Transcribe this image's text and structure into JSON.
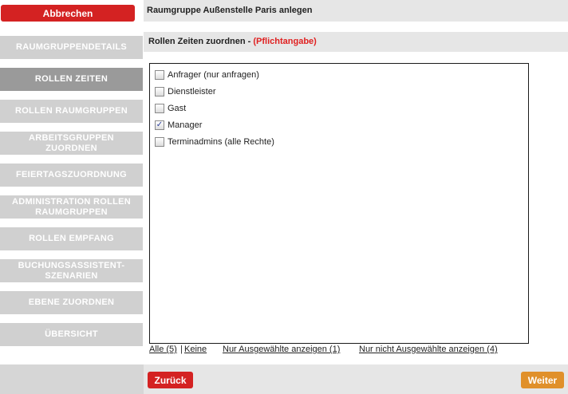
{
  "sidebar": {
    "cancel_label": "Abbrechen",
    "items": [
      {
        "label": "RAUMGRUPPENDETAILS",
        "active": false
      },
      {
        "label": "ROLLEN ZEITEN",
        "active": true
      },
      {
        "label": "ROLLEN RAUMGRUPPEN",
        "active": false
      },
      {
        "label": "ARBEITSGRUPPEN ZUORDNEN",
        "active": false
      },
      {
        "label": "FEIERTAGSZUORDNUNG",
        "active": false
      },
      {
        "label": "ADMINISTRATION ROLLEN RAUMGRUPPEN",
        "active": false
      },
      {
        "label": "ROLLEN EMPFANG",
        "active": false
      },
      {
        "label": "BUCHUNGSASSISTENT-SZENARIEN",
        "active": false
      },
      {
        "label": "EBENE ZUORDNEN",
        "active": false
      },
      {
        "label": "ÜBERSICHT",
        "active": false
      }
    ]
  },
  "header": {
    "title": "Raumgruppe Außenstelle Paris anlegen"
  },
  "section": {
    "title": "Rollen Zeiten zuordnen - ",
    "required": "(Pflichtangabe)"
  },
  "roles": [
    {
      "label": "Anfrager (nur anfragen)",
      "checked": false
    },
    {
      "label": "Dienstleister",
      "checked": false
    },
    {
      "label": "Gast",
      "checked": false
    },
    {
      "label": "Manager",
      "checked": true
    },
    {
      "label": "Terminadmins (alle Rechte)",
      "checked": false
    }
  ],
  "links": {
    "all": "Alle (5)",
    "separator": "|",
    "none": "Keine",
    "show_selected": "Nur Ausgewählte anzeigen (1)",
    "show_unselected": "Nur nicht Ausgewählte anzeigen (4)"
  },
  "footer": {
    "back_label": "Zurück",
    "next_label": "Weiter"
  },
  "colors": {
    "primary_red": "#d42222",
    "next_orange": "#e0902a",
    "nav_inactive": "#d0d0d0",
    "nav_active": "#9a9a9a",
    "required_red": "#e02020"
  }
}
